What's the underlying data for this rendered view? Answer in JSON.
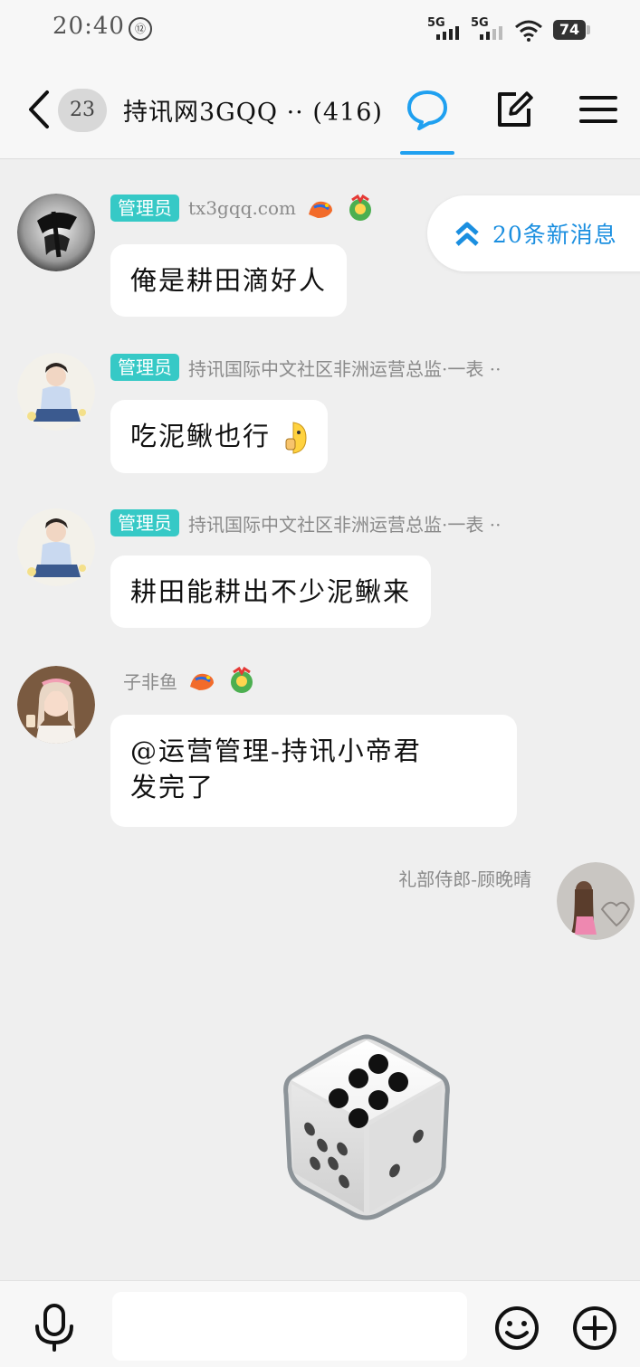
{
  "status_bar": {
    "time": "20:40",
    "signal1_label": "5G",
    "signal2_label": "5G",
    "battery": "74"
  },
  "header": {
    "unread_count": "23",
    "title": "持讯网3GQQ ·· (416)",
    "icons": [
      "back-icon",
      "chat-bubble-icon",
      "edit-icon",
      "menu-icon"
    ],
    "accent_color": "#1fa0f0"
  },
  "new_messages": {
    "label": "20条新消息"
  },
  "messages": [
    {
      "role": "管理员",
      "nickname": "tx3gqq.com",
      "text": "俺是耕田滴好人"
    },
    {
      "role": "管理员",
      "nickname": "持讯国际中文社区非洲运营总监·一表 ··",
      "text": "吃泥鳅也行"
    },
    {
      "role": "管理员",
      "nickname": "持讯国际中文社区非洲运营总监·一表 ··",
      "text": "耕田能耕出不少泥鳅来"
    },
    {
      "role": "",
      "nickname": "子非鱼",
      "text_line1": "@运营管理-持讯小帝君",
      "text_line2": "发完了"
    }
  ],
  "self_message": {
    "nickname": "礼部侍郎-顾晚晴",
    "content": "dice"
  },
  "input_bar": {
    "placeholder": "",
    "icons": [
      "microphone-icon",
      "emoji-icon",
      "plus-icon"
    ]
  }
}
